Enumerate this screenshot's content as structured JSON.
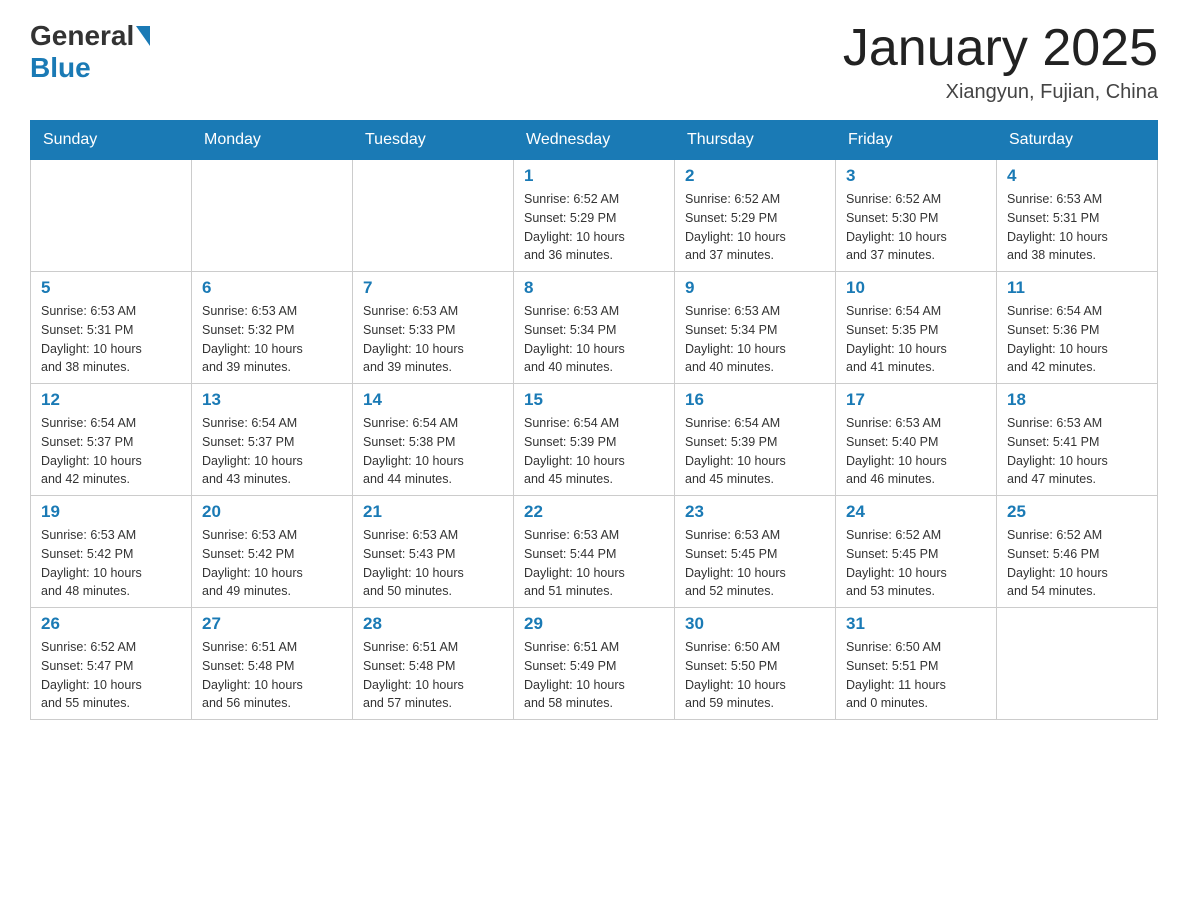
{
  "header": {
    "logo_general": "General",
    "logo_blue": "Blue",
    "title": "January 2025",
    "location": "Xiangyun, Fujian, China"
  },
  "days_of_week": [
    "Sunday",
    "Monday",
    "Tuesday",
    "Wednesday",
    "Thursday",
    "Friday",
    "Saturday"
  ],
  "weeks": [
    [
      {
        "day": "",
        "info": ""
      },
      {
        "day": "",
        "info": ""
      },
      {
        "day": "",
        "info": ""
      },
      {
        "day": "1",
        "info": "Sunrise: 6:52 AM\nSunset: 5:29 PM\nDaylight: 10 hours\nand 36 minutes."
      },
      {
        "day": "2",
        "info": "Sunrise: 6:52 AM\nSunset: 5:29 PM\nDaylight: 10 hours\nand 37 minutes."
      },
      {
        "day": "3",
        "info": "Sunrise: 6:52 AM\nSunset: 5:30 PM\nDaylight: 10 hours\nand 37 minutes."
      },
      {
        "day": "4",
        "info": "Sunrise: 6:53 AM\nSunset: 5:31 PM\nDaylight: 10 hours\nand 38 minutes."
      }
    ],
    [
      {
        "day": "5",
        "info": "Sunrise: 6:53 AM\nSunset: 5:31 PM\nDaylight: 10 hours\nand 38 minutes."
      },
      {
        "day": "6",
        "info": "Sunrise: 6:53 AM\nSunset: 5:32 PM\nDaylight: 10 hours\nand 39 minutes."
      },
      {
        "day": "7",
        "info": "Sunrise: 6:53 AM\nSunset: 5:33 PM\nDaylight: 10 hours\nand 39 minutes."
      },
      {
        "day": "8",
        "info": "Sunrise: 6:53 AM\nSunset: 5:34 PM\nDaylight: 10 hours\nand 40 minutes."
      },
      {
        "day": "9",
        "info": "Sunrise: 6:53 AM\nSunset: 5:34 PM\nDaylight: 10 hours\nand 40 minutes."
      },
      {
        "day": "10",
        "info": "Sunrise: 6:54 AM\nSunset: 5:35 PM\nDaylight: 10 hours\nand 41 minutes."
      },
      {
        "day": "11",
        "info": "Sunrise: 6:54 AM\nSunset: 5:36 PM\nDaylight: 10 hours\nand 42 minutes."
      }
    ],
    [
      {
        "day": "12",
        "info": "Sunrise: 6:54 AM\nSunset: 5:37 PM\nDaylight: 10 hours\nand 42 minutes."
      },
      {
        "day": "13",
        "info": "Sunrise: 6:54 AM\nSunset: 5:37 PM\nDaylight: 10 hours\nand 43 minutes."
      },
      {
        "day": "14",
        "info": "Sunrise: 6:54 AM\nSunset: 5:38 PM\nDaylight: 10 hours\nand 44 minutes."
      },
      {
        "day": "15",
        "info": "Sunrise: 6:54 AM\nSunset: 5:39 PM\nDaylight: 10 hours\nand 45 minutes."
      },
      {
        "day": "16",
        "info": "Sunrise: 6:54 AM\nSunset: 5:39 PM\nDaylight: 10 hours\nand 45 minutes."
      },
      {
        "day": "17",
        "info": "Sunrise: 6:53 AM\nSunset: 5:40 PM\nDaylight: 10 hours\nand 46 minutes."
      },
      {
        "day": "18",
        "info": "Sunrise: 6:53 AM\nSunset: 5:41 PM\nDaylight: 10 hours\nand 47 minutes."
      }
    ],
    [
      {
        "day": "19",
        "info": "Sunrise: 6:53 AM\nSunset: 5:42 PM\nDaylight: 10 hours\nand 48 minutes."
      },
      {
        "day": "20",
        "info": "Sunrise: 6:53 AM\nSunset: 5:42 PM\nDaylight: 10 hours\nand 49 minutes."
      },
      {
        "day": "21",
        "info": "Sunrise: 6:53 AM\nSunset: 5:43 PM\nDaylight: 10 hours\nand 50 minutes."
      },
      {
        "day": "22",
        "info": "Sunrise: 6:53 AM\nSunset: 5:44 PM\nDaylight: 10 hours\nand 51 minutes."
      },
      {
        "day": "23",
        "info": "Sunrise: 6:53 AM\nSunset: 5:45 PM\nDaylight: 10 hours\nand 52 minutes."
      },
      {
        "day": "24",
        "info": "Sunrise: 6:52 AM\nSunset: 5:45 PM\nDaylight: 10 hours\nand 53 minutes."
      },
      {
        "day": "25",
        "info": "Sunrise: 6:52 AM\nSunset: 5:46 PM\nDaylight: 10 hours\nand 54 minutes."
      }
    ],
    [
      {
        "day": "26",
        "info": "Sunrise: 6:52 AM\nSunset: 5:47 PM\nDaylight: 10 hours\nand 55 minutes."
      },
      {
        "day": "27",
        "info": "Sunrise: 6:51 AM\nSunset: 5:48 PM\nDaylight: 10 hours\nand 56 minutes."
      },
      {
        "day": "28",
        "info": "Sunrise: 6:51 AM\nSunset: 5:48 PM\nDaylight: 10 hours\nand 57 minutes."
      },
      {
        "day": "29",
        "info": "Sunrise: 6:51 AM\nSunset: 5:49 PM\nDaylight: 10 hours\nand 58 minutes."
      },
      {
        "day": "30",
        "info": "Sunrise: 6:50 AM\nSunset: 5:50 PM\nDaylight: 10 hours\nand 59 minutes."
      },
      {
        "day": "31",
        "info": "Sunrise: 6:50 AM\nSunset: 5:51 PM\nDaylight: 11 hours\nand 0 minutes."
      },
      {
        "day": "",
        "info": ""
      }
    ]
  ]
}
